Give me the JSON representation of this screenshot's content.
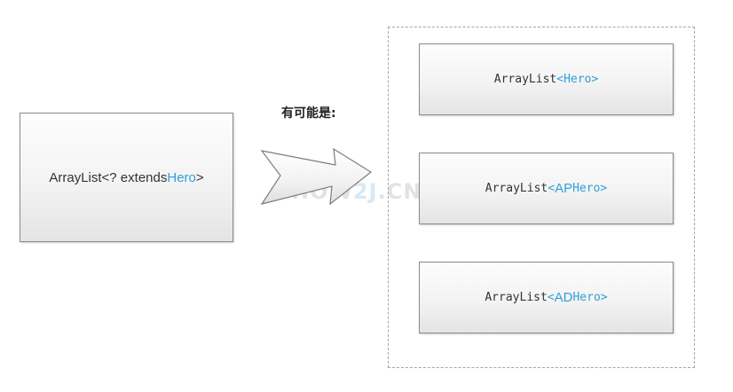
{
  "source": {
    "prefix": "ArrayList<? extends ",
    "type": "Hero",
    "suffix": ">"
  },
  "caption": "有可能是:",
  "watermark": {
    "part1": "HOW",
    "part2": "2J",
    "part3": ".CN"
  },
  "options": [
    {
      "prefix": "ArrayList",
      "open": "<",
      "tag": "",
      "type": "Hero",
      "close": ">"
    },
    {
      "prefix": "ArrayList",
      "open": "<",
      "tag": "AP",
      "type": "Hero",
      "close": ">"
    },
    {
      "prefix": "ArrayList",
      "open": "<",
      "tag": "AD",
      "type": "Hero",
      "close": ">"
    }
  ],
  "colors": {
    "accent": "#2f9fd8",
    "text": "#333333",
    "border": "#8a8a8a"
  }
}
